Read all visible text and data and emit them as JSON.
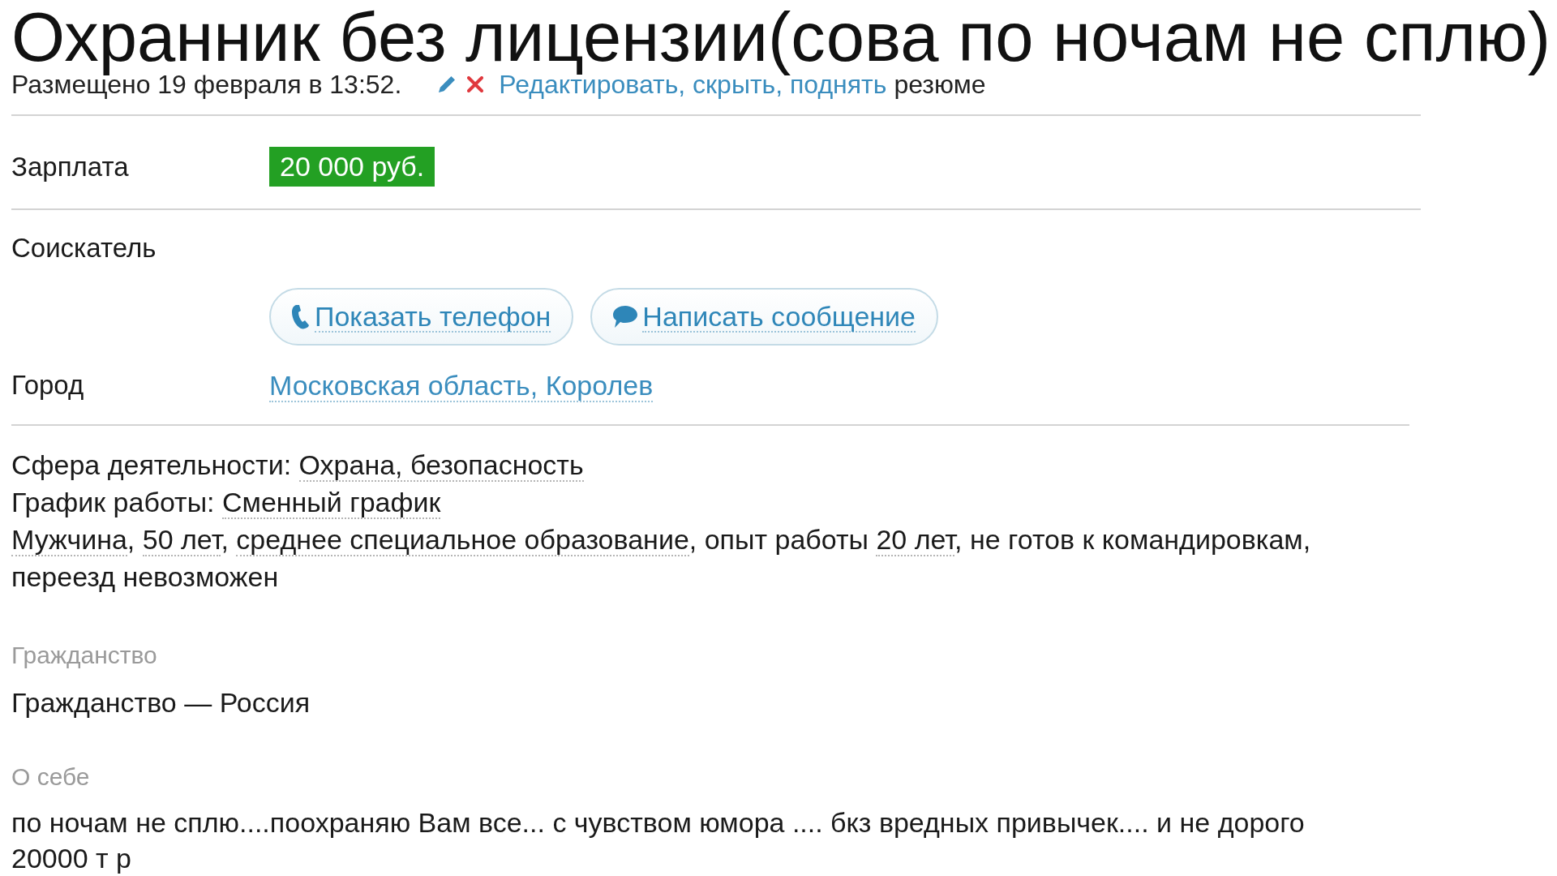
{
  "title": "Охранник без лицензии(сова по ночам не сплю)",
  "meta": {
    "posted": "Размещено 19 февраля в 13:52.",
    "actions_link": "Редактировать, скрыть, поднять",
    "actions_suffix": "резюме"
  },
  "fields": [
    {
      "label": "Зарплата",
      "kind": "salary",
      "value": "20 000 руб."
    },
    {
      "label": "Соискатель",
      "kind": "contacts",
      "buttons": [
        {
          "kind": "phone",
          "label": "Показать телефон"
        },
        {
          "kind": "message",
          "label": "Написать сообщение"
        }
      ]
    },
    {
      "label": "Город",
      "kind": "link",
      "value": "Московская область, Королев"
    }
  ],
  "summary": [
    {
      "parts": [
        {
          "kind": "text",
          "text": "Сфера деятельности: "
        },
        {
          "kind": "link",
          "text": "Охрана, безопасность"
        }
      ]
    },
    {
      "parts": [
        {
          "kind": "text",
          "text": "График работы: "
        },
        {
          "kind": "link",
          "text": "Сменный график"
        }
      ]
    },
    {
      "parts": [
        {
          "kind": "link",
          "text": "Мужчина"
        },
        {
          "kind": "text",
          "text": ", "
        },
        {
          "kind": "link",
          "text": "50 лет"
        },
        {
          "kind": "text",
          "text": ", "
        },
        {
          "kind": "link",
          "text": "среднее специальное образование"
        },
        {
          "kind": "text",
          "text": ", опыт работы "
        },
        {
          "kind": "link",
          "text": "20 лет"
        },
        {
          "kind": "text",
          "text": ", не готов к командировкам, переезд невозможен"
        }
      ]
    }
  ],
  "sections": [
    {
      "heading": "Гражданство",
      "text": "Гражданство — Россия"
    },
    {
      "heading": "О себе",
      "text": "по ночам не сплю....поохраняю Вам все... с чувством юмора .... бкз вредных привычек.... и не дорого 20000 т р"
    }
  ]
}
